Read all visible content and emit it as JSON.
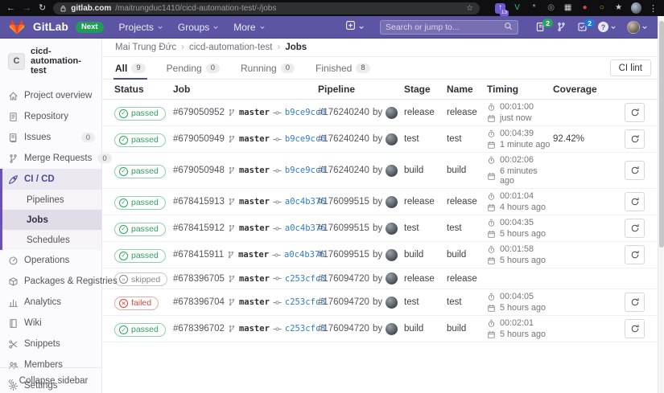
{
  "browser": {
    "url_host": "gitlab.com",
    "url_path": "/maitrungduc1410/cicd-automation-test/-/jobs",
    "extension_icons": [
      {
        "name": "upload-extension-icon",
        "glyph": "↑",
        "fg": "#ffffff",
        "bg": "#6a5acd",
        "badge": "13"
      },
      {
        "name": "vue-devtools-icon",
        "glyph": "V",
        "fg": "#42b883",
        "bg": ""
      },
      {
        "name": "extension-icon-snowflake",
        "glyph": "*",
        "fg": "#b9b9b9",
        "bg": ""
      },
      {
        "name": "extension-icon-ring",
        "glyph": "◎",
        "fg": "#9a9a9a",
        "bg": ""
      },
      {
        "name": "extension-icon-card",
        "glyph": "▦",
        "fg": "#d8d8d8",
        "bg": ""
      },
      {
        "name": "extension-icon-red-dot",
        "glyph": "●",
        "fg": "#e0443e",
        "bg": ""
      },
      {
        "name": "extension-icon-gold-ring",
        "glyph": "○",
        "fg": "#d4a017",
        "bg": ""
      },
      {
        "name": "extension-icon-star",
        "glyph": "★",
        "fg": "#cccccc",
        "bg": ""
      }
    ]
  },
  "navbar": {
    "brand": "GitLab",
    "next_badge": "Next",
    "menus": [
      "Projects",
      "Groups",
      "More"
    ],
    "search_placeholder": "Search or jump to...",
    "issues_count": "2",
    "todos_count": "2",
    "help_glyph": "?"
  },
  "sidebar": {
    "project_initial": "C",
    "project_name": "cicd-automation-test",
    "items": [
      {
        "icon": "home-icon",
        "label": "Project overview"
      },
      {
        "icon": "repository-icon",
        "label": "Repository"
      },
      {
        "icon": "issues-icon",
        "label": "Issues",
        "badge": "0"
      },
      {
        "icon": "merge-request-icon",
        "label": "Merge Requests",
        "badge": "0"
      },
      {
        "icon": "rocket-icon",
        "label": "CI / CD",
        "active": true,
        "children": [
          "Pipelines",
          "Jobs",
          "Schedules"
        ],
        "active_child": "Jobs"
      },
      {
        "icon": "operations-icon",
        "label": "Operations"
      },
      {
        "icon": "package-icon",
        "label": "Packages & Registries"
      },
      {
        "icon": "analytics-icon",
        "label": "Analytics"
      },
      {
        "icon": "wiki-icon",
        "label": "Wiki"
      },
      {
        "icon": "snippets-icon",
        "label": "Snippets"
      },
      {
        "icon": "members-icon",
        "label": "Members"
      },
      {
        "icon": "settings-icon",
        "label": "Settings"
      }
    ],
    "collapse_label": "Collapse sidebar"
  },
  "breadcrumb": [
    "Mai Trung Đức",
    "cicd-automation-test",
    "Jobs"
  ],
  "tabs": [
    {
      "label": "All",
      "count": "9",
      "active": true
    },
    {
      "label": "Pending",
      "count": "0",
      "active": false
    },
    {
      "label": "Running",
      "count": "0",
      "active": false
    },
    {
      "label": "Finished",
      "count": "8",
      "active": false
    }
  ],
  "ci_lint_label": "CI lint",
  "table": {
    "headers": [
      "Status",
      "Job",
      "Pipeline",
      "Stage",
      "Name",
      "Timing",
      "Coverage",
      ""
    ],
    "by_label": "by",
    "rows": [
      {
        "status": "passed",
        "job": "#679050952",
        "branch": "master",
        "commit": "b9ce9cc0",
        "pipeline": "#176240240",
        "stage": "release",
        "name": "release",
        "duration": "00:01:00",
        "finished": "just now",
        "coverage": "",
        "retry": true
      },
      {
        "status": "passed",
        "job": "#679050949",
        "branch": "master",
        "commit": "b9ce9cc0",
        "pipeline": "#176240240",
        "stage": "test",
        "name": "test",
        "duration": "00:04:39",
        "finished": "1 minute ago",
        "coverage": "92.42%",
        "retry": true
      },
      {
        "status": "passed",
        "job": "#679050948",
        "branch": "master",
        "commit": "b9ce9cc0",
        "pipeline": "#176240240",
        "stage": "build",
        "name": "build",
        "duration": "00:02:06",
        "finished": "6 minutes ago",
        "coverage": "",
        "retry": true
      },
      {
        "status": "passed",
        "job": "#678415913",
        "branch": "master",
        "commit": "a0c4b376",
        "pipeline": "#176099515",
        "stage": "release",
        "name": "release",
        "duration": "00:01:04",
        "finished": "4 hours ago",
        "coverage": "",
        "retry": true
      },
      {
        "status": "passed",
        "job": "#678415912",
        "branch": "master",
        "commit": "a0c4b376",
        "pipeline": "#176099515",
        "stage": "test",
        "name": "test",
        "duration": "00:04:35",
        "finished": "5 hours ago",
        "coverage": "",
        "retry": true
      },
      {
        "status": "passed",
        "job": "#678415911",
        "branch": "master",
        "commit": "a0c4b376",
        "pipeline": "#176099515",
        "stage": "build",
        "name": "build",
        "duration": "00:01:58",
        "finished": "5 hours ago",
        "coverage": "",
        "retry": true
      },
      {
        "status": "skipped",
        "job": "#678396705",
        "branch": "master",
        "commit": "c253cfc3",
        "pipeline": "#176094720",
        "stage": "release",
        "name": "release",
        "duration": "",
        "finished": "",
        "coverage": "",
        "retry": false
      },
      {
        "status": "failed",
        "job": "#678396704",
        "branch": "master",
        "commit": "c253cfc3",
        "pipeline": "#176094720",
        "stage": "test",
        "name": "test",
        "duration": "00:04:05",
        "finished": "5 hours ago",
        "coverage": "",
        "retry": true
      },
      {
        "status": "passed",
        "job": "#678396702",
        "branch": "master",
        "commit": "c253cfc3",
        "pipeline": "#176094720",
        "stage": "build",
        "name": "build",
        "duration": "00:02:01",
        "finished": "5 hours ago",
        "coverage": "",
        "retry": true
      }
    ]
  },
  "colors": {
    "navbar": "#5c55a4",
    "accent": "#4b4b8f",
    "sidebar_accent": "#6b4fbb",
    "link": "#2e7cd5",
    "passed": "#2da160",
    "failed": "#d9453c",
    "skipped": "#86868c",
    "next_green": "#1f9d57",
    "badge_green": "#2da160",
    "badge_blue": "#1f78d1",
    "brand_orange": "#e24329"
  }
}
